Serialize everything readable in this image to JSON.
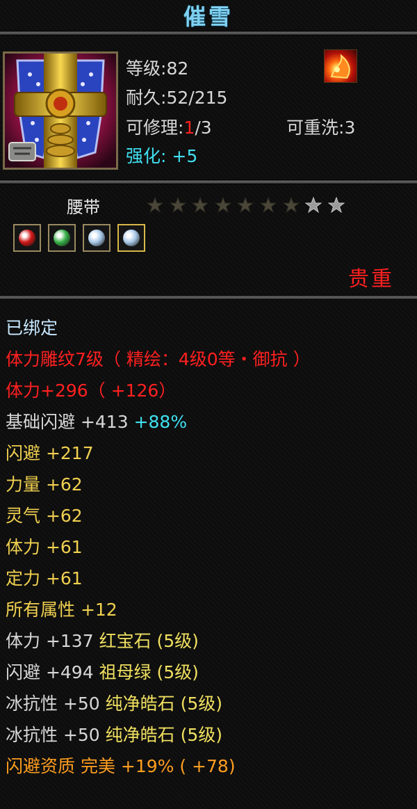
{
  "item": {
    "name": "催雪",
    "level_label": "等级",
    "level_value": "82",
    "durability_label": "耐久",
    "durability_value": "52/215",
    "repair_label": "可修理",
    "repair_current": "1",
    "repair_max": "/3",
    "rewash_label": "可重洗",
    "rewash_value": "3",
    "enhance_label": "强化",
    "enhance_value": "+5",
    "type": "腰带",
    "stars_filled": 7,
    "stars_total": 9,
    "rarity": "贵重",
    "icon": "belt-icon",
    "school_icon": "fire-school-icon"
  },
  "gems": [
    {
      "icon": "ruby-gem-icon",
      "color": "#d01818",
      "active": false
    },
    {
      "icon": "emerald-gem-icon",
      "color": "#38b048",
      "active": false
    },
    {
      "icon": "pure-sapphire-gem-icon",
      "color": "#a8c8e8",
      "active": false
    },
    {
      "icon": "pure-sapphire-gem-icon",
      "color": "#a8c8e8",
      "active": true
    }
  ],
  "attributes": [
    {
      "parts": [
        {
          "text": "已绑定",
          "cls": "c-light"
        }
      ]
    },
    {
      "parts": [
        {
          "text": "体力雕纹7级（ 精绘：4级0等・御抗 ）",
          "cls": "c-red"
        }
      ]
    },
    {
      "parts": [
        {
          "text": "体力+296（ +126）",
          "cls": "c-red"
        }
      ]
    },
    {
      "parts": [
        {
          "text": "基础闪避 +413 ",
          "cls": "c-white"
        },
        {
          "text": "+88%",
          "cls": "cyan"
        }
      ]
    },
    {
      "parts": [
        {
          "text": "闪避 +217",
          "cls": "c-yellow"
        }
      ]
    },
    {
      "parts": [
        {
          "text": "力量 +62",
          "cls": "c-yellow"
        }
      ]
    },
    {
      "parts": [
        {
          "text": "灵气 +62",
          "cls": "c-yellow"
        }
      ]
    },
    {
      "parts": [
        {
          "text": "体力 +61",
          "cls": "c-yellow"
        }
      ]
    },
    {
      "parts": [
        {
          "text": "定力 +61",
          "cls": "c-yellow"
        }
      ]
    },
    {
      "parts": [
        {
          "text": "所有属性 +12",
          "cls": "c-yellow"
        }
      ]
    },
    {
      "parts": [
        {
          "text": "体力 +137 ",
          "cls": "c-white"
        },
        {
          "text": "红宝石 (5级)",
          "cls": "c-gold"
        }
      ]
    },
    {
      "parts": [
        {
          "text": "闪避 +494 ",
          "cls": "c-white"
        },
        {
          "text": "祖母绿 (5级)",
          "cls": "c-gold"
        }
      ]
    },
    {
      "parts": [
        {
          "text": "冰抗性 +50 ",
          "cls": "c-white"
        },
        {
          "text": "纯净皓石 (5级)",
          "cls": "c-gold"
        }
      ]
    },
    {
      "parts": [
        {
          "text": "冰抗性 +50 ",
          "cls": "c-white"
        },
        {
          "text": "纯净皓石 (5级)",
          "cls": "c-gold"
        }
      ]
    },
    {
      "parts": [
        {
          "text": "闪避资质 完美 +19% ( +78)",
          "cls": "c-orange"
        }
      ]
    }
  ]
}
